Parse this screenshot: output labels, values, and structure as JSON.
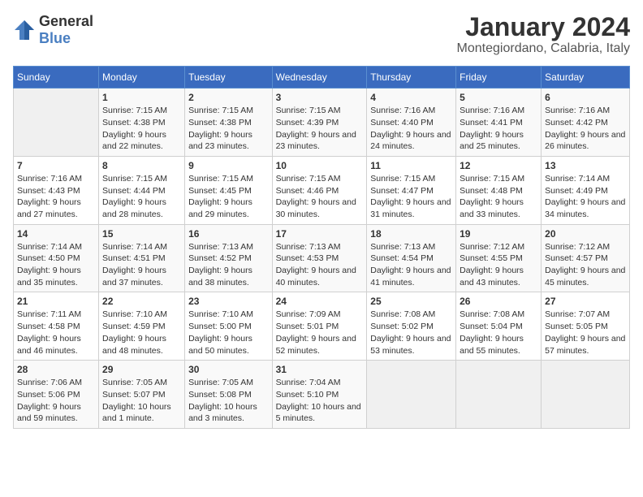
{
  "logo": {
    "text_general": "General",
    "text_blue": "Blue"
  },
  "title": {
    "month": "January 2024",
    "location": "Montegiordano, Calabria, Italy"
  },
  "weekdays": [
    "Sunday",
    "Monday",
    "Tuesday",
    "Wednesday",
    "Thursday",
    "Friday",
    "Saturday"
  ],
  "weeks": [
    [
      {
        "day": "",
        "sunrise": "",
        "sunset": "",
        "daylight": ""
      },
      {
        "day": "1",
        "sunrise": "Sunrise: 7:15 AM",
        "sunset": "Sunset: 4:38 PM",
        "daylight": "Daylight: 9 hours and 22 minutes."
      },
      {
        "day": "2",
        "sunrise": "Sunrise: 7:15 AM",
        "sunset": "Sunset: 4:38 PM",
        "daylight": "Daylight: 9 hours and 23 minutes."
      },
      {
        "day": "3",
        "sunrise": "Sunrise: 7:15 AM",
        "sunset": "Sunset: 4:39 PM",
        "daylight": "Daylight: 9 hours and 23 minutes."
      },
      {
        "day": "4",
        "sunrise": "Sunrise: 7:16 AM",
        "sunset": "Sunset: 4:40 PM",
        "daylight": "Daylight: 9 hours and 24 minutes."
      },
      {
        "day": "5",
        "sunrise": "Sunrise: 7:16 AM",
        "sunset": "Sunset: 4:41 PM",
        "daylight": "Daylight: 9 hours and 25 minutes."
      },
      {
        "day": "6",
        "sunrise": "Sunrise: 7:16 AM",
        "sunset": "Sunset: 4:42 PM",
        "daylight": "Daylight: 9 hours and 26 minutes."
      }
    ],
    [
      {
        "day": "7",
        "sunrise": "Sunrise: 7:16 AM",
        "sunset": "Sunset: 4:43 PM",
        "daylight": "Daylight: 9 hours and 27 minutes."
      },
      {
        "day": "8",
        "sunrise": "Sunrise: 7:15 AM",
        "sunset": "Sunset: 4:44 PM",
        "daylight": "Daylight: 9 hours and 28 minutes."
      },
      {
        "day": "9",
        "sunrise": "Sunrise: 7:15 AM",
        "sunset": "Sunset: 4:45 PM",
        "daylight": "Daylight: 9 hours and 29 minutes."
      },
      {
        "day": "10",
        "sunrise": "Sunrise: 7:15 AM",
        "sunset": "Sunset: 4:46 PM",
        "daylight": "Daylight: 9 hours and 30 minutes."
      },
      {
        "day": "11",
        "sunrise": "Sunrise: 7:15 AM",
        "sunset": "Sunset: 4:47 PM",
        "daylight": "Daylight: 9 hours and 31 minutes."
      },
      {
        "day": "12",
        "sunrise": "Sunrise: 7:15 AM",
        "sunset": "Sunset: 4:48 PM",
        "daylight": "Daylight: 9 hours and 33 minutes."
      },
      {
        "day": "13",
        "sunrise": "Sunrise: 7:14 AM",
        "sunset": "Sunset: 4:49 PM",
        "daylight": "Daylight: 9 hours and 34 minutes."
      }
    ],
    [
      {
        "day": "14",
        "sunrise": "Sunrise: 7:14 AM",
        "sunset": "Sunset: 4:50 PM",
        "daylight": "Daylight: 9 hours and 35 minutes."
      },
      {
        "day": "15",
        "sunrise": "Sunrise: 7:14 AM",
        "sunset": "Sunset: 4:51 PM",
        "daylight": "Daylight: 9 hours and 37 minutes."
      },
      {
        "day": "16",
        "sunrise": "Sunrise: 7:13 AM",
        "sunset": "Sunset: 4:52 PM",
        "daylight": "Daylight: 9 hours and 38 minutes."
      },
      {
        "day": "17",
        "sunrise": "Sunrise: 7:13 AM",
        "sunset": "Sunset: 4:53 PM",
        "daylight": "Daylight: 9 hours and 40 minutes."
      },
      {
        "day": "18",
        "sunrise": "Sunrise: 7:13 AM",
        "sunset": "Sunset: 4:54 PM",
        "daylight": "Daylight: 9 hours and 41 minutes."
      },
      {
        "day": "19",
        "sunrise": "Sunrise: 7:12 AM",
        "sunset": "Sunset: 4:55 PM",
        "daylight": "Daylight: 9 hours and 43 minutes."
      },
      {
        "day": "20",
        "sunrise": "Sunrise: 7:12 AM",
        "sunset": "Sunset: 4:57 PM",
        "daylight": "Daylight: 9 hours and 45 minutes."
      }
    ],
    [
      {
        "day": "21",
        "sunrise": "Sunrise: 7:11 AM",
        "sunset": "Sunset: 4:58 PM",
        "daylight": "Daylight: 9 hours and 46 minutes."
      },
      {
        "day": "22",
        "sunrise": "Sunrise: 7:10 AM",
        "sunset": "Sunset: 4:59 PM",
        "daylight": "Daylight: 9 hours and 48 minutes."
      },
      {
        "day": "23",
        "sunrise": "Sunrise: 7:10 AM",
        "sunset": "Sunset: 5:00 PM",
        "daylight": "Daylight: 9 hours and 50 minutes."
      },
      {
        "day": "24",
        "sunrise": "Sunrise: 7:09 AM",
        "sunset": "Sunset: 5:01 PM",
        "daylight": "Daylight: 9 hours and 52 minutes."
      },
      {
        "day": "25",
        "sunrise": "Sunrise: 7:08 AM",
        "sunset": "Sunset: 5:02 PM",
        "daylight": "Daylight: 9 hours and 53 minutes."
      },
      {
        "day": "26",
        "sunrise": "Sunrise: 7:08 AM",
        "sunset": "Sunset: 5:04 PM",
        "daylight": "Daylight: 9 hours and 55 minutes."
      },
      {
        "day": "27",
        "sunrise": "Sunrise: 7:07 AM",
        "sunset": "Sunset: 5:05 PM",
        "daylight": "Daylight: 9 hours and 57 minutes."
      }
    ],
    [
      {
        "day": "28",
        "sunrise": "Sunrise: 7:06 AM",
        "sunset": "Sunset: 5:06 PM",
        "daylight": "Daylight: 9 hours and 59 minutes."
      },
      {
        "day": "29",
        "sunrise": "Sunrise: 7:05 AM",
        "sunset": "Sunset: 5:07 PM",
        "daylight": "Daylight: 10 hours and 1 minute."
      },
      {
        "day": "30",
        "sunrise": "Sunrise: 7:05 AM",
        "sunset": "Sunset: 5:08 PM",
        "daylight": "Daylight: 10 hours and 3 minutes."
      },
      {
        "day": "31",
        "sunrise": "Sunrise: 7:04 AM",
        "sunset": "Sunset: 5:10 PM",
        "daylight": "Daylight: 10 hours and 5 minutes."
      },
      {
        "day": "",
        "sunrise": "",
        "sunset": "",
        "daylight": ""
      },
      {
        "day": "",
        "sunrise": "",
        "sunset": "",
        "daylight": ""
      },
      {
        "day": "",
        "sunrise": "",
        "sunset": "",
        "daylight": ""
      }
    ]
  ]
}
